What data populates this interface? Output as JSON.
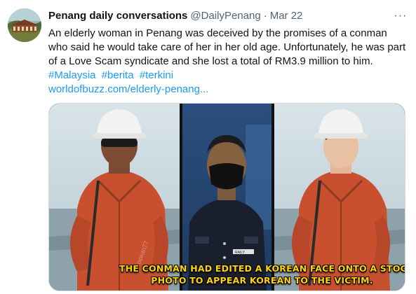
{
  "tweet": {
    "display_name": "Penang daily conversations",
    "handle": "@DailyPenang",
    "separator": "·",
    "date": "Mar 22",
    "more_label": "···",
    "body": "An elderly woman in Penang was deceived by the promises of a conman who said he would take care of her in her old age. Unfortunately, he was part of a Love Scam syndicate and she lost a total of RM3.9 million to him.",
    "hashtags": [
      "#Malaysia",
      "#berita",
      "#terkini"
    ],
    "link": "worldofbuzz.com/elderly-penang..."
  },
  "media": {
    "caption_line1": "The conman had edited a Korean face onto a stock",
    "caption_line2": "photo to appear Korean to the victim.",
    "badge_text": "RAILY",
    "watermark": "ocean77"
  },
  "colors": {
    "link": "#1d9bf0",
    "text": "#0f1419",
    "muted": "#536471",
    "caption": "#ffd400",
    "coverall": "#c8502f"
  }
}
